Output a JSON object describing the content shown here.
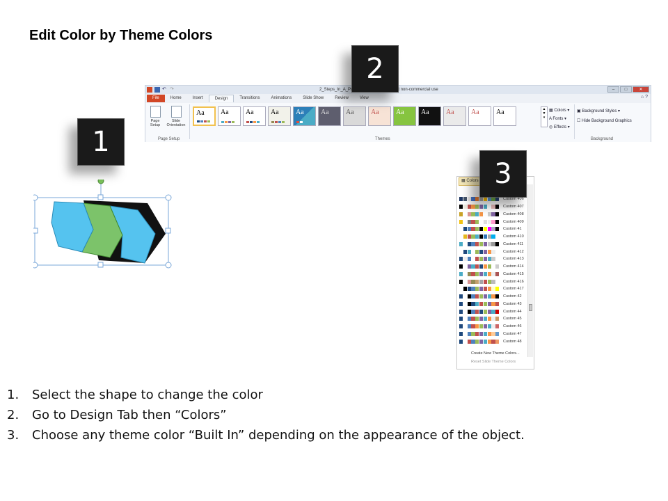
{
  "title": "Edit Color by Theme Colors",
  "badges": [
    "1",
    "2",
    "3"
  ],
  "ribbon": {
    "window_title": "2_Steps_In_A_Pr… - Microsoft PowerPoint non-commercial use",
    "tabs": [
      "File",
      "Home",
      "Insert",
      "Design",
      "Transitions",
      "Animations",
      "Slide Show",
      "Review",
      "View"
    ],
    "active_tab": "Design",
    "page_setup_label": "Page Setup",
    "slide_orientation_label": "Slide Orientation",
    "page_setup_group": "Page Setup",
    "themes_group": "Themes",
    "theme_label": "Aa",
    "colors_btn": "Colors",
    "fonts_btn": "Fonts",
    "effects_btn": "Effects",
    "bg_styles": "Background Styles",
    "hide_bg": "Hide Background Graphics",
    "background_group": "Background"
  },
  "dropdown": {
    "header": "Colors",
    "items": [
      "Custom 406",
      "Custom 407",
      "Custom 408",
      "Custom 409",
      "Custom 41",
      "Custom 410",
      "Custom 411",
      "Custom 412",
      "Custom 413",
      "Custom 414",
      "Custom 415",
      "Custom 416",
      "Custom 417",
      "Custom 42",
      "Custom 43",
      "Custom 44",
      "Custom 45",
      "Custom 46",
      "Custom 47",
      "Custom 48"
    ],
    "create_new": "Create New Theme Colors...",
    "reset": "Reset Slide Theme Colors"
  },
  "steps": [
    {
      "num": "1.",
      "text": "Select the shape to change the color"
    },
    {
      "num": "2.",
      "text": "Go to Design Tab then “Colors”"
    },
    {
      "num": "3.",
      "text": "Choose any theme color “Built In” depending on the appearance of the object."
    }
  ],
  "colors": {
    "badge_bg": "#1a1a1a",
    "arrow_blue": "#55c3ef",
    "arrow_green": "#7cc36a",
    "file_tab": "#d24726",
    "selection_handle": "#7aa7d8",
    "rotate_handle": "#7ac35a"
  }
}
